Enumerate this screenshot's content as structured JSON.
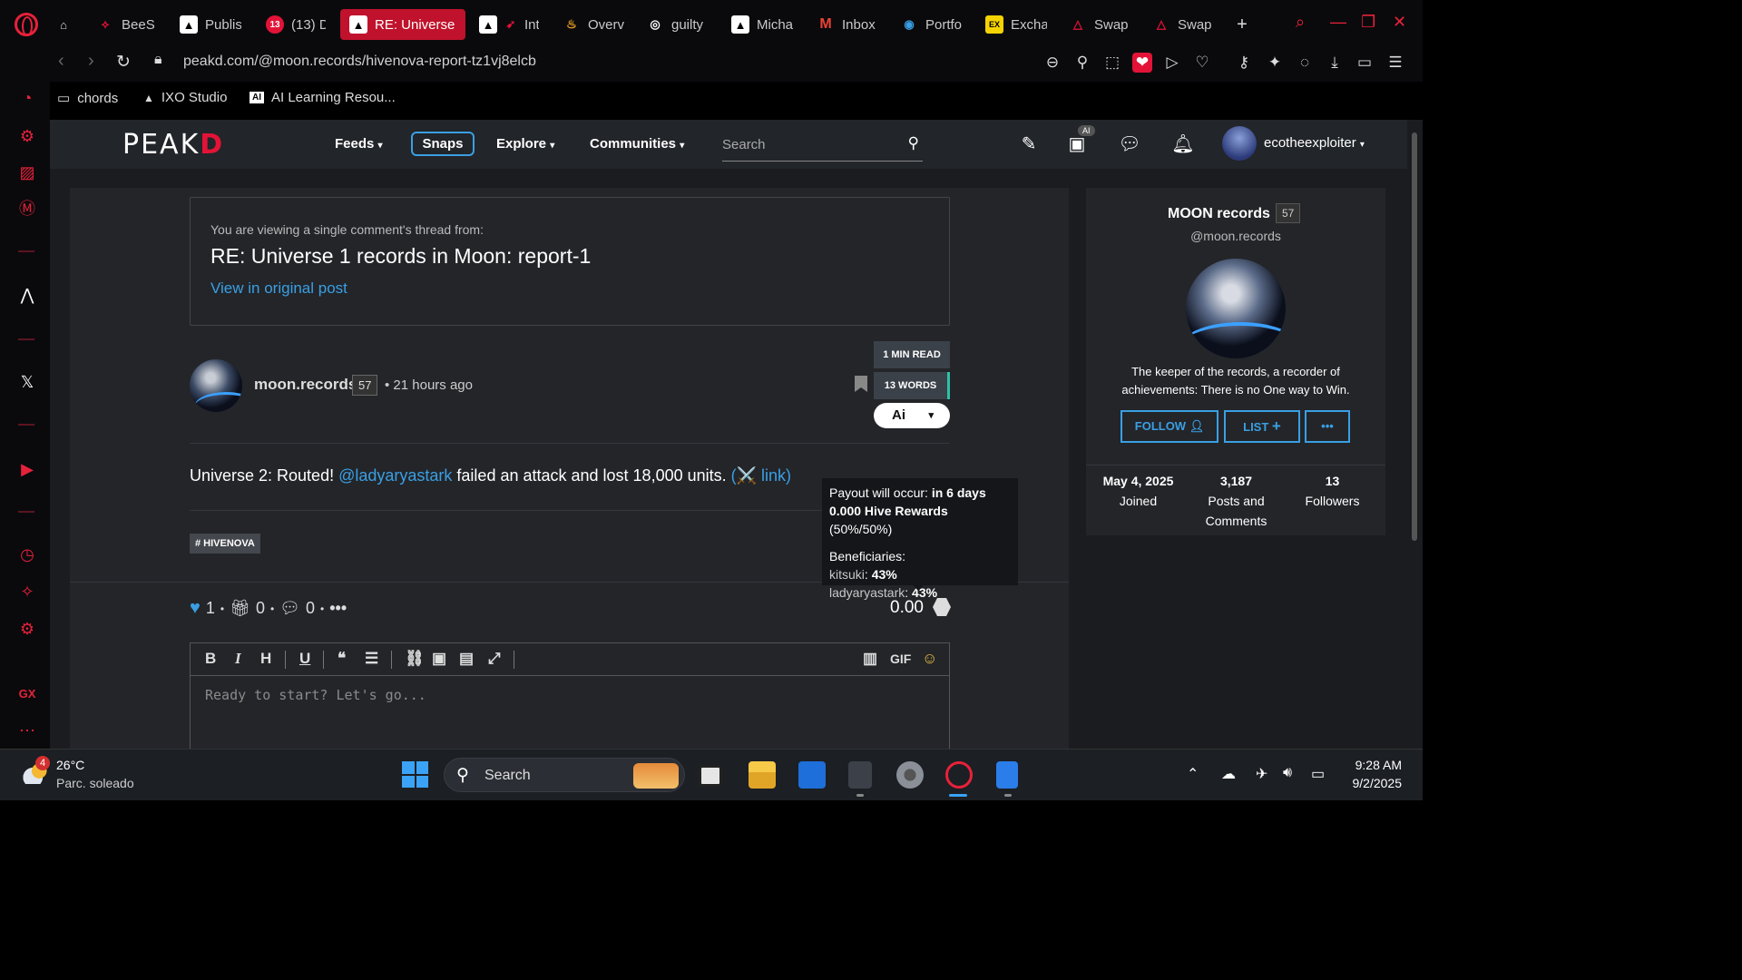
{
  "tabs": [
    {
      "label": "BeeS",
      "icon": "hive-icon",
      "color": "#e31337"
    },
    {
      "label": "Publis",
      "icon": "peakd-icon",
      "color": "#ffffff"
    },
    {
      "label": "(13) D",
      "icon": "notification-icon",
      "badge": "13",
      "color": "#e31337"
    },
    {
      "label": "RE: Universe",
      "icon": "peakd-icon",
      "color": "#ffffff",
      "active": true
    },
    {
      "label": "Int",
      "icon": "rocket-icon",
      "color": "#ffffff"
    },
    {
      "label": "Overv",
      "icon": "flame-icon",
      "color": "#f5a623"
    },
    {
      "label": "guilty",
      "icon": "globe-icon",
      "color": "#ffffff"
    },
    {
      "label": "Micha",
      "icon": "peakd-icon",
      "color": "#ffffff"
    },
    {
      "label": "Inbox",
      "icon": "gmail-icon",
      "color": "#ea4335"
    },
    {
      "label": "Portfo",
      "icon": "coin-icon",
      "color": "#3a9fe3"
    },
    {
      "label": "Excha",
      "icon": "exchange-icon",
      "color": "#f5d300"
    },
    {
      "label": "Swap",
      "icon": "swap-icon",
      "color": "#e31337"
    },
    {
      "label": "Swap",
      "icon": "swap-icon",
      "color": "#e31337"
    }
  ],
  "address": {
    "url": "peakd.com/@moon.records/hivenova-report-tz1vj8elcb"
  },
  "bookmarks": [
    {
      "label": "chords",
      "icon": "folder-icon"
    },
    {
      "label": "IXO Studio",
      "icon": "triangle-icon"
    },
    {
      "label": "AI Learning Resou...",
      "icon": "ai-icon"
    }
  ],
  "header": {
    "logo_main": "PEAK",
    "logo_d": "D",
    "nav": {
      "feeds": "Feeds",
      "snaps": "Snaps",
      "explore": "Explore",
      "communities": "Communities"
    },
    "search_placeholder": "Search",
    "ai_badge": "AI",
    "username": "ecotheexploiter"
  },
  "thread": {
    "subtitle": "You are viewing a single comment's thread from:",
    "title": "RE: Universe 1 records in Moon: report-1",
    "link": "View in original post"
  },
  "post": {
    "author": "moon.records",
    "reputation": "57",
    "time": "• 21 hours ago",
    "read_time": "1 MIN READ",
    "words": "13 WORDS",
    "ai_label": "Ai",
    "body_prefix": "Universe 2: Routed! ",
    "mention": "@ladyaryastark",
    "body_middle": " failed an attack and lost 18,000 units. ",
    "body_link": "(⚔️ link)",
    "tag": "# HIVENOVA",
    "votes": "1",
    "gifts": "0",
    "comments": "0",
    "payout": "0.00"
  },
  "tooltip": {
    "line1_label": "Payout will occur: ",
    "line1_value": "in 6 days",
    "line2_value": "0.000 Hive Rewards",
    "line2_label": " (50%/50%)",
    "beneficiaries_label": "Beneficiaries:",
    "beneficiaries": [
      {
        "name": "kitsuki",
        "share": "43%"
      },
      {
        "name": "ladyaryastark",
        "share": "43%"
      }
    ]
  },
  "editor": {
    "placeholder": "Ready to start? Let's go...",
    "gif_label": "GIF"
  },
  "profile": {
    "name": "MOON records",
    "reputation": "57",
    "handle": "@moon.records",
    "bio": "The keeper of the records, a recorder of achievements: There is no One way to Win.",
    "follow": "FOLLOW",
    "list": "LIST",
    "more": "•••",
    "joined_value": "May 4, 2025",
    "joined_label": "Joined",
    "posts_value": "3,187",
    "posts_label": "Posts and Comments",
    "followers_value": "13",
    "followers_label": "Followers"
  },
  "taskbar": {
    "weather_badge": "4",
    "temp": "26°C",
    "weather_desc": "Parc. soleado",
    "search_label": "Search",
    "time": "9:28 AM",
    "date": "9/2/2025"
  },
  "colors": {
    "accent_blue": "#3a9fe3",
    "hive_red": "#e31337",
    "opera_red": "#e8213a"
  }
}
